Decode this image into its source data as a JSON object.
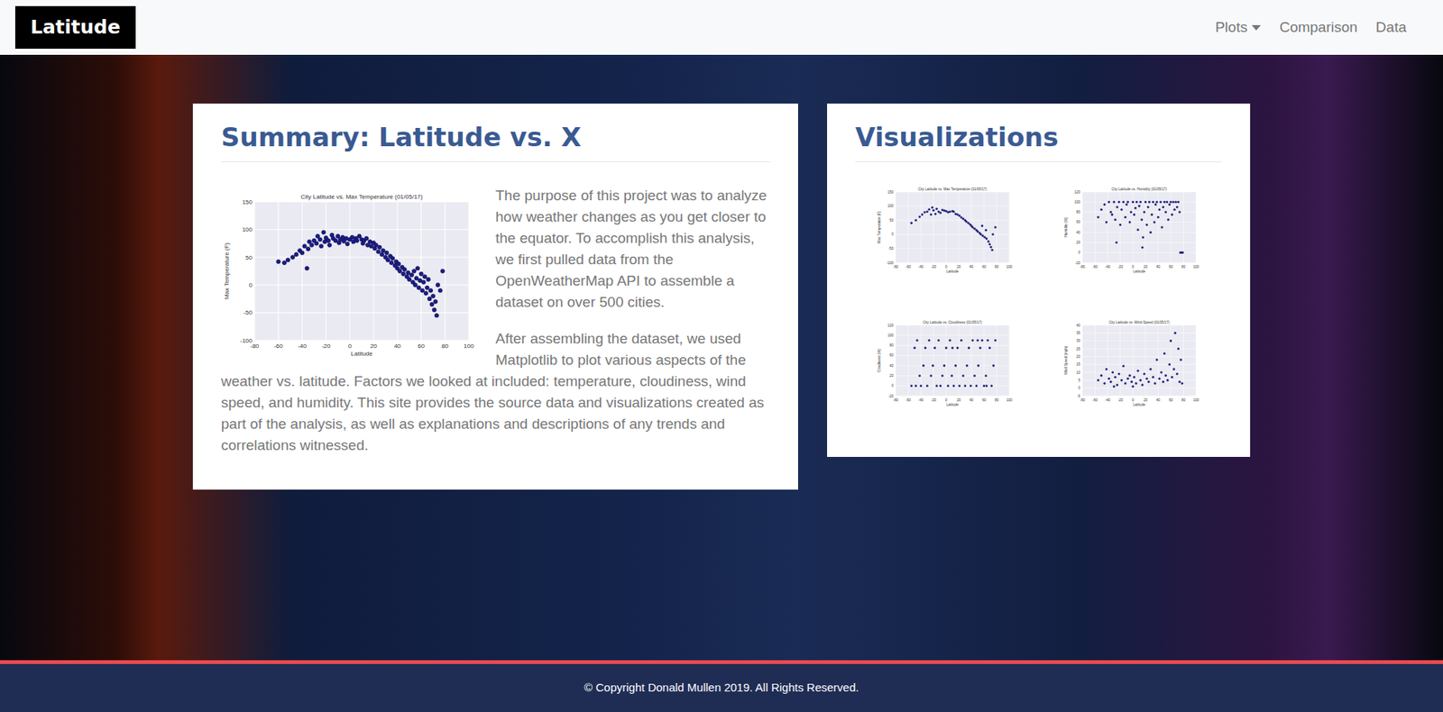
{
  "nav": {
    "brand": "Latitude",
    "items": [
      {
        "label": "Plots",
        "dropdown": true
      },
      {
        "label": "Comparison",
        "dropdown": false
      },
      {
        "label": "Data",
        "dropdown": false
      }
    ]
  },
  "summary": {
    "heading": "Summary: Latitude vs. X",
    "paragraphs": [
      "The purpose of this project was to analyze how weather changes as you get closer to the equator. To accomplish this analysis, we first pulled data from the OpenWeatherMap API to assemble a dataset on over 500 cities.",
      "After assembling the dataset, we used Matplotlib to plot various aspects of the weather vs. latitude. Factors we looked at included: temperature, cloudiness, wind speed, and humidity. This site provides the source data and visualizations created as part of the analysis, as well as explanations and descriptions of any trends and correlations witnessed."
    ],
    "chart": {
      "title": "City Latitude vs. Max Temperature (01/05/17)",
      "x_label": "Latitude",
      "y_label": "Max Temperature (F)",
      "x_ticks": [
        "-80",
        "-60",
        "-40",
        "-20",
        "0",
        "20",
        "40",
        "60",
        "80",
        "100"
      ],
      "y_ticks": [
        "-100",
        "-50",
        "0",
        "50",
        "100",
        "150"
      ],
      "points": [
        [
          -55,
          40
        ],
        [
          -52,
          45
        ],
        [
          -48,
          50
        ],
        [
          -45,
          55
        ],
        [
          -42,
          62
        ],
        [
          -40,
          58
        ],
        [
          -38,
          70
        ],
        [
          -35,
          65
        ],
        [
          -34,
          78
        ],
        [
          -32,
          72
        ],
        [
          -30,
          80
        ],
        [
          -28,
          75
        ],
        [
          -27,
          88
        ],
        [
          -25,
          82
        ],
        [
          -24,
          70
        ],
        [
          -22,
          95
        ],
        [
          -21,
          78
        ],
        [
          -20,
          85
        ],
        [
          -18,
          80
        ],
        [
          -17,
          72
        ],
        [
          -15,
          90
        ],
        [
          -14,
          84
        ],
        [
          -12,
          80
        ],
        [
          -10,
          88
        ],
        [
          -9,
          76
        ],
        [
          -8,
          82
        ],
        [
          -6,
          86
        ],
        [
          -5,
          79
        ],
        [
          -3,
          84
        ],
        [
          -2,
          74
        ],
        [
          0,
          82
        ],
        [
          2,
          86
        ],
        [
          3,
          78
        ],
        [
          5,
          84
        ],
        [
          6,
          80
        ],
        [
          8,
          88
        ],
        [
          10,
          82
        ],
        [
          11,
          75
        ],
        [
          12,
          80
        ],
        [
          14,
          84
        ],
        [
          15,
          72
        ],
        [
          17,
          78
        ],
        [
          18,
          70
        ],
        [
          20,
          76
        ],
        [
          21,
          66
        ],
        [
          22,
          72
        ],
        [
          24,
          60
        ],
        [
          25,
          68
        ],
        [
          27,
          55
        ],
        [
          28,
          62
        ],
        [
          30,
          50
        ],
        [
          31,
          58
        ],
        [
          32,
          45
        ],
        [
          34,
          52
        ],
        [
          35,
          40
        ],
        [
          36,
          48
        ],
        [
          38,
          35
        ],
        [
          39,
          42
        ],
        [
          40,
          30
        ],
        [
          41,
          38
        ],
        [
          42,
          25
        ],
        [
          44,
          32
        ],
        [
          45,
          20
        ],
        [
          46,
          28
        ],
        [
          48,
          15
        ],
        [
          49,
          22
        ],
        [
          50,
          10
        ],
        [
          52,
          18
        ],
        [
          53,
          5
        ],
        [
          54,
          25
        ],
        [
          55,
          0
        ],
        [
          56,
          12
        ],
        [
          57,
          30
        ],
        [
          58,
          -5
        ],
        [
          59,
          8
        ],
        [
          60,
          20
        ],
        [
          61,
          -10
        ],
        [
          62,
          5
        ],
        [
          63,
          15
        ],
        [
          64,
          -15
        ],
        [
          65,
          -5
        ],
        [
          66,
          10
        ],
        [
          67,
          -25
        ],
        [
          68,
          -10
        ],
        [
          69,
          -35
        ],
        [
          70,
          -20
        ],
        [
          71,
          -45
        ],
        [
          72,
          -30
        ],
        [
          73,
          -55
        ],
        [
          74,
          0
        ],
        [
          76,
          -10
        ],
        [
          78,
          25
        ],
        [
          -60,
          42
        ],
        [
          -36,
          30
        ]
      ]
    }
  },
  "visualizations": {
    "heading": "Visualizations",
    "charts": [
      {
        "title": "City Latitude vs. Max Temperature (01/05/17)",
        "x_label": "Latitude",
        "y_label": "Max Temperature (F)",
        "x_ticks": [
          "-80",
          "-60",
          "-40",
          "-20",
          "0",
          "20",
          "40",
          "60",
          "80",
          "100"
        ],
        "y_ticks": [
          "-100",
          "-50",
          "0",
          "50",
          "100",
          "150"
        ],
        "points": [
          [
            -55,
            40
          ],
          [
            -48,
            50
          ],
          [
            -42,
            62
          ],
          [
            -38,
            70
          ],
          [
            -34,
            78
          ],
          [
            -30,
            80
          ],
          [
            -27,
            88
          ],
          [
            -24,
            70
          ],
          [
            -22,
            95
          ],
          [
            -20,
            85
          ],
          [
            -17,
            72
          ],
          [
            -15,
            90
          ],
          [
            -12,
            80
          ],
          [
            -9,
            76
          ],
          [
            -6,
            86
          ],
          [
            -3,
            84
          ],
          [
            0,
            82
          ],
          [
            3,
            78
          ],
          [
            6,
            80
          ],
          [
            10,
            82
          ],
          [
            12,
            80
          ],
          [
            15,
            72
          ],
          [
            18,
            70
          ],
          [
            21,
            66
          ],
          [
            24,
            60
          ],
          [
            27,
            55
          ],
          [
            30,
            50
          ],
          [
            32,
            45
          ],
          [
            35,
            40
          ],
          [
            38,
            35
          ],
          [
            40,
            30
          ],
          [
            42,
            25
          ],
          [
            45,
            20
          ],
          [
            48,
            15
          ],
          [
            50,
            10
          ],
          [
            53,
            5
          ],
          [
            55,
            0
          ],
          [
            57,
            30
          ],
          [
            58,
            -5
          ],
          [
            61,
            -10
          ],
          [
            63,
            15
          ],
          [
            64,
            -15
          ],
          [
            67,
            -25
          ],
          [
            69,
            -35
          ],
          [
            71,
            -45
          ],
          [
            73,
            -55
          ],
          [
            74,
            0
          ],
          [
            78,
            25
          ]
        ]
      },
      {
        "title": "City Latitude vs. Humidity (01/05/17)",
        "x_label": "Latitude",
        "y_label": "Humidity (%)",
        "x_ticks": [
          "-80",
          "-60",
          "-40",
          "-20",
          "0",
          "20",
          "40",
          "60",
          "80",
          "100"
        ],
        "y_ticks": [
          "-20",
          "0",
          "20",
          "40",
          "60",
          "80",
          "100",
          "120"
        ],
        "points": [
          [
            -55,
            70
          ],
          [
            -50,
            85
          ],
          [
            -45,
            95
          ],
          [
            -42,
            60
          ],
          [
            -38,
            100
          ],
          [
            -35,
            80
          ],
          [
            -33,
            75
          ],
          [
            -30,
            100
          ],
          [
            -28,
            65
          ],
          [
            -25,
            90
          ],
          [
            -22,
            100
          ],
          [
            -20,
            55
          ],
          [
            -18,
            85
          ],
          [
            -15,
            100
          ],
          [
            -12,
            70
          ],
          [
            -10,
            95
          ],
          [
            -8,
            100
          ],
          [
            -5,
            60
          ],
          [
            -3,
            80
          ],
          [
            0,
            100
          ],
          [
            2,
            75
          ],
          [
            4,
            88
          ],
          [
            6,
            100
          ],
          [
            8,
            45
          ],
          [
            10,
            92
          ],
          [
            12,
            100
          ],
          [
            14,
            65
          ],
          [
            16,
            30
          ],
          [
            18,
            80
          ],
          [
            20,
            100
          ],
          [
            22,
            55
          ],
          [
            24,
            90
          ],
          [
            26,
            100
          ],
          [
            28,
            40
          ],
          [
            30,
            75
          ],
          [
            32,
            100
          ],
          [
            34,
            60
          ],
          [
            36,
            95
          ],
          [
            38,
            100
          ],
          [
            40,
            70
          ],
          [
            42,
            85
          ],
          [
            44,
            100
          ],
          [
            46,
            50
          ],
          [
            48,
            90
          ],
          [
            50,
            100
          ],
          [
            52,
            80
          ],
          [
            54,
            100
          ],
          [
            56,
            65
          ],
          [
            58,
            95
          ],
          [
            60,
            100
          ],
          [
            62,
            75
          ],
          [
            64,
            100
          ],
          [
            66,
            85
          ],
          [
            68,
            100
          ],
          [
            70,
            90
          ],
          [
            72,
            100
          ],
          [
            74,
            80
          ],
          [
            75,
            0
          ],
          [
            77,
            0
          ],
          [
            79,
            0
          ],
          [
            -26,
            20
          ],
          [
            15,
            10
          ]
        ]
      },
      {
        "title": "City Latitude vs. Cloudiness (01/05/17)",
        "x_label": "Latitude",
        "y_label": "Cloudiness (%)",
        "x_ticks": [
          "-80",
          "-60",
          "-40",
          "-20",
          "0",
          "20",
          "40",
          "60",
          "80",
          "100"
        ],
        "y_ticks": [
          "-20",
          "0",
          "20",
          "40",
          "60",
          "80",
          "100",
          "120"
        ],
        "points": [
          [
            -55,
            0
          ],
          [
            -50,
            75
          ],
          [
            -46,
            90
          ],
          [
            -42,
            20
          ],
          [
            -40,
            0
          ],
          [
            -36,
            40
          ],
          [
            -33,
            75
          ],
          [
            -30,
            0
          ],
          [
            -27,
            90
          ],
          [
            -24,
            20
          ],
          [
            -21,
            40
          ],
          [
            -18,
            75
          ],
          [
            -15,
            0
          ],
          [
            -12,
            90
          ],
          [
            -9,
            0
          ],
          [
            -6,
            20
          ],
          [
            -3,
            40
          ],
          [
            0,
            75
          ],
          [
            3,
            0
          ],
          [
            6,
            90
          ],
          [
            9,
            20
          ],
          [
            12,
            0
          ],
          [
            15,
            40
          ],
          [
            18,
            75
          ],
          [
            21,
            0
          ],
          [
            24,
            90
          ],
          [
            27,
            20
          ],
          [
            30,
            0
          ],
          [
            33,
            40
          ],
          [
            36,
            75
          ],
          [
            39,
            0
          ],
          [
            42,
            90
          ],
          [
            45,
            20
          ],
          [
            48,
            0
          ],
          [
            51,
            40
          ],
          [
            54,
            75
          ],
          [
            57,
            90
          ],
          [
            60,
            0
          ],
          [
            63,
            20
          ],
          [
            66,
            90
          ],
          [
            69,
            75
          ],
          [
            72,
            0
          ],
          [
            75,
            40
          ],
          [
            78,
            90
          ],
          [
            -48,
            0
          ],
          [
            10,
            75
          ],
          [
            50,
            90
          ],
          [
            64,
            0
          ]
        ]
      },
      {
        "title": "City Latitude vs. Wind Speed (01/05/17)",
        "x_label": "Latitude",
        "y_label": "Wind Speed (mph)",
        "x_ticks": [
          "-80",
          "-60",
          "-40",
          "-20",
          "0",
          "20",
          "40",
          "60",
          "80",
          "100"
        ],
        "y_ticks": [
          "-5",
          "0",
          "5",
          "10",
          "15",
          "20",
          "25",
          "30",
          "35",
          "40"
        ],
        "points": [
          [
            -55,
            5
          ],
          [
            -50,
            8
          ],
          [
            -45,
            3
          ],
          [
            -42,
            12
          ],
          [
            -38,
            6
          ],
          [
            -35,
            4
          ],
          [
            -32,
            10
          ],
          [
            -28,
            7
          ],
          [
            -25,
            2
          ],
          [
            -22,
            9
          ],
          [
            -18,
            5
          ],
          [
            -15,
            14
          ],
          [
            -12,
            3
          ],
          [
            -8,
            6
          ],
          [
            -5,
            8
          ],
          [
            -2,
            4
          ],
          [
            2,
            7
          ],
          [
            5,
            3
          ],
          [
            8,
            11
          ],
          [
            12,
            5
          ],
          [
            15,
            2
          ],
          [
            18,
            9
          ],
          [
            22,
            6
          ],
          [
            25,
            4
          ],
          [
            28,
            12
          ],
          [
            32,
            7
          ],
          [
            35,
            3
          ],
          [
            38,
            18
          ],
          [
            42,
            6
          ],
          [
            45,
            10
          ],
          [
            48,
            4
          ],
          [
            50,
            22
          ],
          [
            52,
            8
          ],
          [
            55,
            5
          ],
          [
            58,
            15
          ],
          [
            60,
            30
          ],
          [
            62,
            7
          ],
          [
            65,
            12
          ],
          [
            67,
            35
          ],
          [
            70,
            9
          ],
          [
            72,
            25
          ],
          [
            74,
            4
          ],
          [
            76,
            18
          ],
          [
            78,
            3
          ],
          [
            -30,
            1
          ],
          [
            0,
            1
          ]
        ]
      }
    ]
  },
  "footer": {
    "text": "© Copyright Donald Mullen 2019. All Rights Reserved."
  }
}
